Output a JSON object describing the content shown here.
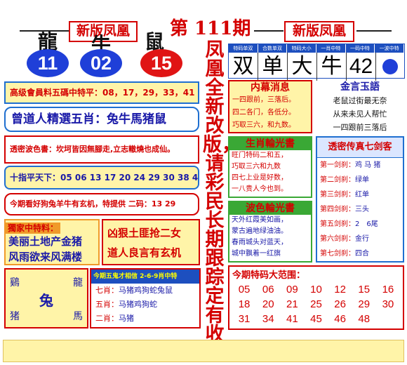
{
  "header": {
    "left_badge": "新版凤凰",
    "issue": "第 111期",
    "right_badge": "新版凤凰"
  },
  "zodiac_chars": [
    "龍",
    "牛",
    "鼠"
  ],
  "balls": [
    {
      "num": "11",
      "color": "#1f3fd8"
    },
    {
      "num": "02",
      "color": "#1f3fd8"
    },
    {
      "num": "15",
      "color": "#e01414"
    }
  ],
  "left": {
    "box1": "高级會員料五碼中特平：08，17，29，33，41",
    "box2": "曾道人精選五肖：兔牛馬猪鼠",
    "box3": "透密波色書：坎坷皆因無腳走,立志轍燒也成仙。",
    "box4": "十指平天下：05 06 13 17 20 24 29 30 38 43",
    "box5": "今期看好狗兔羊牛有玄机，特提供 二码：13 29",
    "exclusive_title": "獨家中特料：",
    "exclusive_lines": [
      "美丽土地产金猪",
      "风雨欲来风满楼"
    ],
    "right_poem": [
      "凶狠土匪抢二女",
      "道人良言有玄机"
    ],
    "corner": {
      "tl": "鷄",
      "tr": "龍",
      "center": "兔",
      "bl": "猪",
      "br": "馬"
    },
    "five_title": "今期五鬼才相信 2-6-9肖中特",
    "five_rows": [
      {
        "label": "七肖：",
        "value": "马猪鸡狗蛇兔鼠"
      },
      {
        "label": "五肖：",
        "value": "马猪鸡狗蛇"
      },
      {
        "label": "二肖：",
        "value": "马猪"
      }
    ]
  },
  "vertical_text": "凤凰全新改版，请彩民长期跟踪定有收获。",
  "right": {
    "table_headers": [
      "特码单双",
      "合数单双",
      "特码大小",
      "一肖中特",
      "一码中特",
      "一波中特"
    ],
    "answers": [
      "双",
      "单",
      "大",
      "牛",
      "42"
    ],
    "wave_dot_color": "#1f3fd8",
    "inside_title": "内幕消息",
    "inside_lines": [
      "一四跟前，三落后。",
      "四二各门，各低分。",
      "巧取三六，和九数。"
    ],
    "golden_title": "金言玉語",
    "golden_lines": [
      "老鼠过街最无奈",
      "从来未见人帮忙",
      "一四跟前三落后"
    ],
    "zodiac_title": "生肖輪光書",
    "zodiac_lines": [
      "旺门特码二和五，",
      "巧取三六和九数",
      "四七上业是好数，",
      "一八贵人今也到。"
    ],
    "wave_title": "波色輪光書",
    "wave_lines": [
      "天外红霞美如画，",
      "蒙古遍地绿油油。",
      "春雨城头对蓝天，",
      "城中飘着一红旗"
    ],
    "sword_title": "透密传真七剑客",
    "swords": [
      {
        "label": "第一剑刹：",
        "value": "鸡 马 猪"
      },
      {
        "label": "第二剑刹：",
        "value": "绿单"
      },
      {
        "label": "第三剑刹：",
        "value": "红单"
      },
      {
        "label": "第四剑刹：",
        "value": "三头"
      },
      {
        "label": "第五剑刹：",
        "value": "2　6尾"
      },
      {
        "label": "第六剑刹：",
        "value": "金行"
      },
      {
        "label": "第七剑刹：",
        "value": "四合"
      }
    ],
    "range_title": "今期特码大范围：",
    "range_numbers": [
      "05",
      "06",
      "09",
      "10",
      "12",
      "15",
      "16",
      "18",
      "20",
      "21",
      "25",
      "26",
      "29",
      "30",
      "31",
      "34",
      "41",
      "45",
      "46",
      "48"
    ]
  }
}
